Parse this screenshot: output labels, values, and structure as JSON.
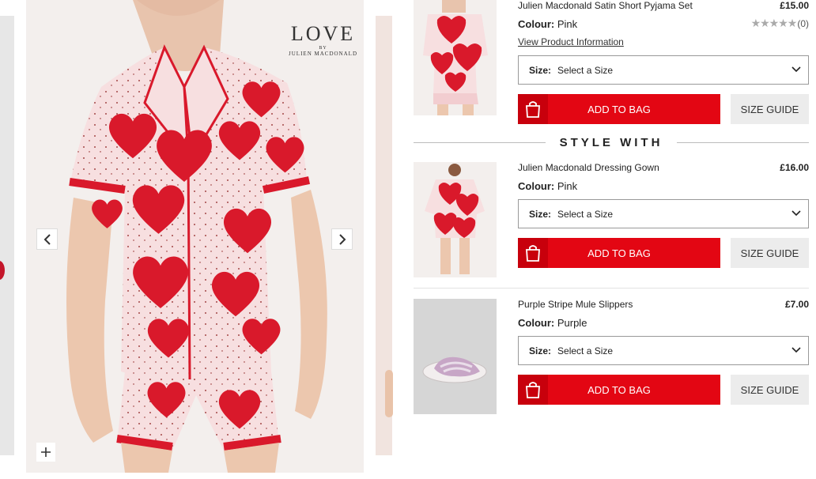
{
  "gallery": {
    "brand_love": "LOVE",
    "brand_by": "BY",
    "brand_name": "JULIEN MACDONALD"
  },
  "products": [
    {
      "name": "Julien Macdonald Satin Short Pyjama Set",
      "price": "£15.00",
      "colour_label": "Colour:",
      "colour": "Pink",
      "rating_count": "(0)",
      "view_link": "View Product Information",
      "size_label": "Size:",
      "size_value": "Select a Size",
      "add_label": "ADD TO BAG",
      "guide_label": "SIZE GUIDE"
    },
    {
      "name": "Julien Macdonald Dressing Gown",
      "price": "£16.00",
      "colour_label": "Colour:",
      "colour": "Pink",
      "size_label": "Size:",
      "size_value": "Select a Size",
      "add_label": "ADD TO BAG",
      "guide_label": "SIZE GUIDE"
    },
    {
      "name": "Purple Stripe Mule Slippers",
      "price": "£7.00",
      "colour_label": "Colour:",
      "colour": "Purple",
      "size_label": "Size:",
      "size_value": "Select a Size",
      "add_label": "ADD TO BAG",
      "guide_label": "SIZE GUIDE"
    }
  ],
  "style_with": "STYLE WITH",
  "colors": {
    "accent": "#e30613",
    "accent_dark": "#c8000c",
    "heart": "#d9192b",
    "fabric": "#f6dadb"
  },
  "icons": [
    "chevron-left-icon",
    "chevron-right-icon",
    "plus-icon",
    "star-icon",
    "chevron-down-icon",
    "bag-icon"
  ]
}
